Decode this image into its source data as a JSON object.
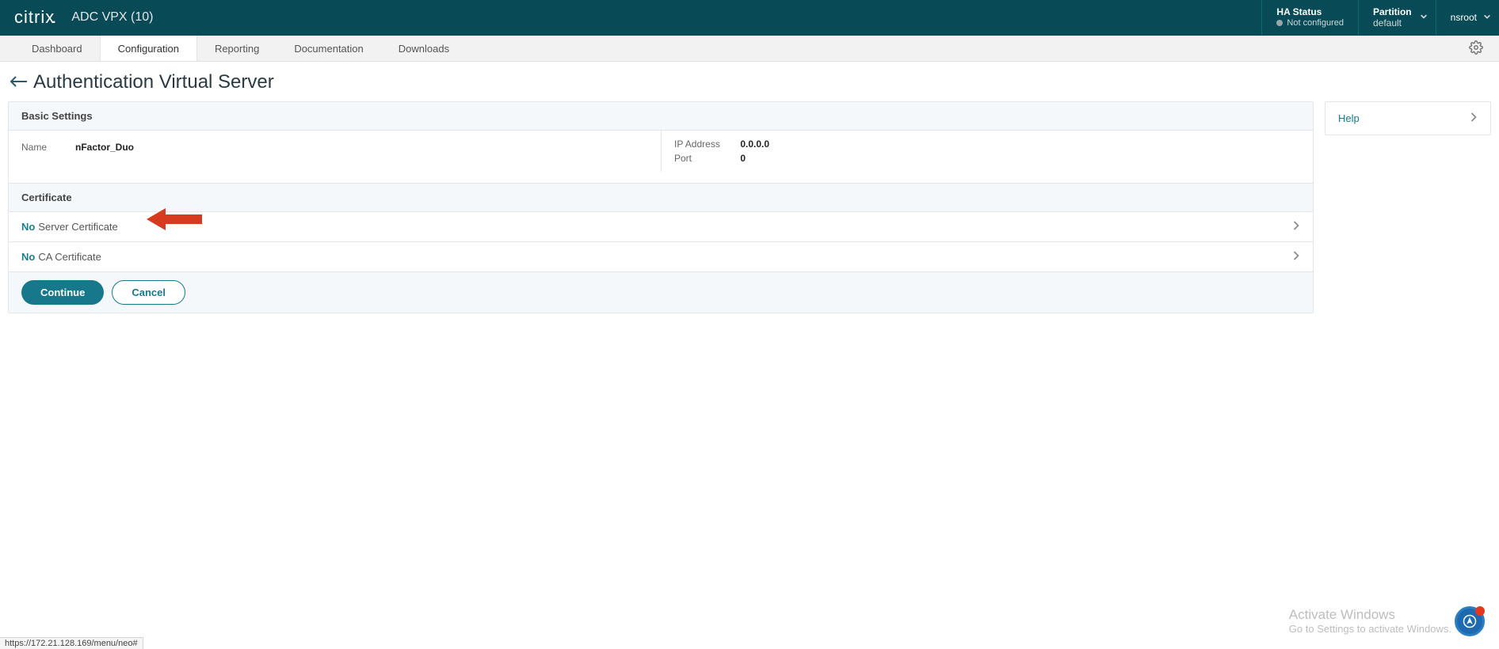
{
  "header": {
    "brand": "citrix",
    "product": "ADC VPX (10)",
    "ha_title": "HA Status",
    "ha_sub": "Not configured",
    "partition_label": "Partition",
    "partition_value": "default",
    "user": "nsroot"
  },
  "nav": {
    "tabs": [
      "Dashboard",
      "Configuration",
      "Reporting",
      "Documentation",
      "Downloads"
    ],
    "active_index": 1
  },
  "page": {
    "title": "Authentication Virtual Server"
  },
  "basic": {
    "heading": "Basic Settings",
    "name_label": "Name",
    "name_value": "nFactor_Duo",
    "ip_label": "IP Address",
    "ip_value": "0.0.0.0",
    "port_label": "Port",
    "port_value": "0"
  },
  "cert": {
    "heading": "Certificate",
    "server_count": "No",
    "server_text": "Server Certificate",
    "ca_count": "No",
    "ca_text": "CA Certificate"
  },
  "buttons": {
    "continue": "Continue",
    "cancel": "Cancel"
  },
  "help": {
    "label": "Help"
  },
  "watermark": {
    "line1": "Activate Windows",
    "line2": "Go to Settings to activate Windows."
  },
  "status_url": "https://172.21.128.169/menu/neo#"
}
